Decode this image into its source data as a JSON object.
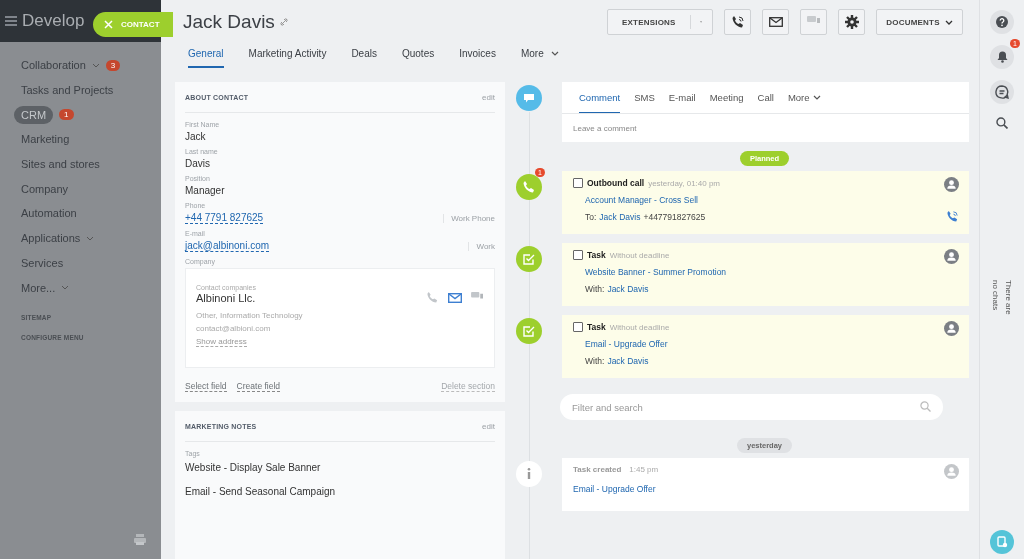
{
  "sidebar": {
    "title": "Develop",
    "contact_pill": {
      "label": "CONTACT"
    },
    "items": [
      {
        "label": "Collaboration",
        "selected": false,
        "expandable": true,
        "badge": "3"
      },
      {
        "label": "Tasks and Projects",
        "selected": false,
        "expandable": false
      },
      {
        "label": "CRM",
        "selected": true,
        "expandable": false,
        "badge": "1"
      },
      {
        "label": "Marketing",
        "selected": false,
        "expandable": false
      },
      {
        "label": "Sites and stores",
        "selected": false,
        "expandable": false
      },
      {
        "label": "Company",
        "selected": false,
        "expandable": false
      },
      {
        "label": "Automation",
        "selected": false,
        "expandable": false
      },
      {
        "label": "Applications",
        "selected": false,
        "expandable": true
      },
      {
        "label": "Services",
        "selected": false,
        "expandable": false
      },
      {
        "label": "More...",
        "selected": false,
        "expandable": true
      }
    ],
    "links": [
      "SITEMAP",
      "CONFIGURE MENU"
    ]
  },
  "header": {
    "title": "Jack Davis",
    "extensions": "EXTENSIONS",
    "documents": "DOCUMENTS",
    "chat_disabled": true
  },
  "tabs": [
    {
      "label": "General",
      "selected": true
    },
    {
      "label": "Marketing Activity",
      "selected": false
    },
    {
      "label": "Deals",
      "selected": false
    },
    {
      "label": "Quotes",
      "selected": false
    },
    {
      "label": "Invoices",
      "selected": false
    },
    {
      "label": "More",
      "selected": false
    }
  ],
  "about": {
    "title": "ABOUT CONTACT",
    "edit": "edit",
    "fields": [
      {
        "label": "First Name",
        "value": "Jack",
        "kind": "text"
      },
      {
        "label": "Last name",
        "value": "Davis",
        "kind": "text"
      },
      {
        "label": "Position",
        "value": "Manager",
        "kind": "text"
      },
      {
        "label": "Phone",
        "value": "+44 7791 827625",
        "kind": "link",
        "type": "Work Phone"
      },
      {
        "label": "E-mail",
        "value": "jack@albinoni.com",
        "kind": "link",
        "type": "Work"
      }
    ],
    "company": {
      "label": "Company",
      "caption": "Contact companies",
      "name": "Albinoni Llc.",
      "industry": "Other, Information Technology",
      "email": "contact@albioni.com",
      "address": "Show address"
    },
    "select_field": "Select field",
    "create_field": "Create field",
    "delete_section": "Delete section"
  },
  "notes": {
    "title": "MARKETING NOTES",
    "edit": "edit",
    "label": "Tags",
    "values": [
      "Website - Display Sale Banner",
      "Email - Send Seasonal Campaign"
    ]
  },
  "composer": {
    "tabs": [
      {
        "label": "Comment",
        "selected": true
      },
      {
        "label": "SMS",
        "selected": false
      },
      {
        "label": "E-mail",
        "selected": false
      },
      {
        "label": "Meeting",
        "selected": false
      },
      {
        "label": "Call",
        "selected": false
      },
      {
        "label": "More",
        "selected": false
      }
    ],
    "placeholder": "Leave a comment"
  },
  "planned_label": "Planned",
  "activities": [
    {
      "kind": "call",
      "title": "Outbound call",
      "time": "yesterday, 01:40 pm",
      "checked": false,
      "badge": "1",
      "link": "Account Manager - Cross Sell",
      "prefix": "To:",
      "person": "Jack Davis",
      "extra": "+447791827625"
    },
    {
      "kind": "task",
      "title": "Task",
      "time": "Without deadline",
      "checked": false,
      "link": "Website Banner - Summer Promotion",
      "prefix": "With:",
      "person": "Jack Davis"
    },
    {
      "kind": "task",
      "title": "Task",
      "time": "Without deadline",
      "checked": false,
      "link": "Email - Upgrade Offer",
      "prefix": "With:",
      "person": "Jack Davis"
    }
  ],
  "filter": {
    "placeholder": "Filter and search"
  },
  "history_label": "yesterday",
  "history": [
    {
      "kind": "info",
      "title": "Task created",
      "time": "1:45 pm",
      "link": "Email - Upgrade Offer"
    }
  ],
  "right_bar": {
    "bell_badge": "1",
    "chats_note": "There are no chats"
  }
}
